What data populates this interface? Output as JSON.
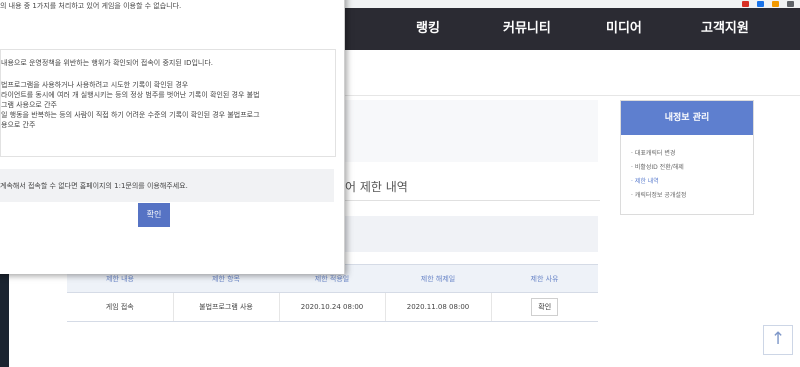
{
  "topnav": {
    "items": [
      "랭킹",
      "커뮤니티",
      "미디어",
      "고객지원"
    ]
  },
  "content": {
    "heading": "어 제한 내역"
  },
  "table": {
    "headers": [
      "제한 내용",
      "제한 항목",
      "제한 적용일",
      "제한 해제일",
      "제한 사유"
    ],
    "rows": [
      [
        "게임 접속",
        "불법프로그램 사용",
        "2020.10.24 08:00",
        "2020.11.08 08:00",
        "확인"
      ]
    ]
  },
  "side_panel": {
    "title": "내정보 관리",
    "items": [
      "대표캐릭터 변경",
      "비활성ID 전환/해제",
      "제한 내역",
      "캐릭터정보 공개설정"
    ],
    "active_index": 2
  },
  "modal": {
    "intro": "의 내용 중 1가지를 처리하고 있어 게임을 이용할 수 없습니다.",
    "box_lines": [
      "내용으로 운영정책을 위반하는 행위가 확인되어 접속이 중지된 ID입니다.",
      "",
      "법프로그램을 사용하거나 사용하려고 시도한 기록이 확인된 경우",
      "라이언트를 동시에 여러 개 실행시키는 등의 정상 범주를 벗어난 기록이 확인된 경우 불법",
      "그램 사용으로 간주",
      "일 행동을 반복하는 등의 사람이 직접 하기 어려운 수준의 기록이 확인된 경우 불법프로그",
      "용으로 간주"
    ],
    "notice": "계속해서 접속할 수 없다면 홈페이지의 1:1문의를 이용해주세요.",
    "confirm_label": "확인"
  },
  "scroll_top_icon": "arrow-up-icon",
  "colors": {
    "nav_bg": "#2b2b33",
    "accent": "#5e7fcf",
    "button": "#5673c4"
  }
}
